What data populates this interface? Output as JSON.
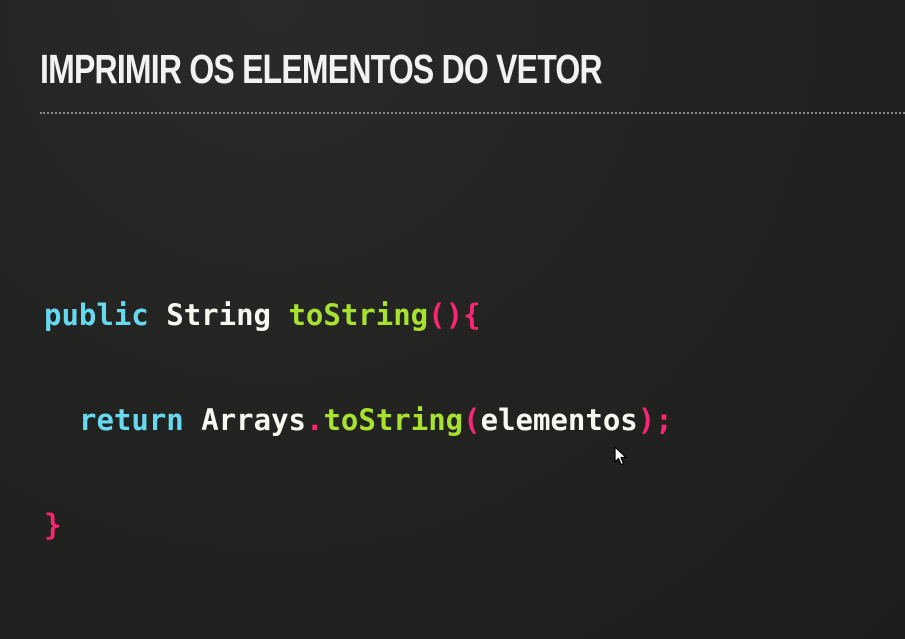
{
  "slide": {
    "title": "IMPRIMIR OS ELEMENTOS DO VETOR"
  },
  "code": {
    "line1": {
      "keyword": "public",
      "type": "String",
      "method": "toString",
      "parens": "()",
      "brace": "{"
    },
    "line2": {
      "keyword": "return",
      "class": "Arrays",
      "dot": ".",
      "method": "toString",
      "open_paren": "(",
      "argument": "elementos",
      "close": ");"
    },
    "line3": {
      "brace": "}"
    }
  },
  "colors": {
    "background": "#232322",
    "keyword": "#66d9ef",
    "method": "#a6e22e",
    "punctuation": "#f92672",
    "text": "#f8f8f2"
  },
  "icons": {
    "cursor": "mouse-pointer-icon"
  }
}
